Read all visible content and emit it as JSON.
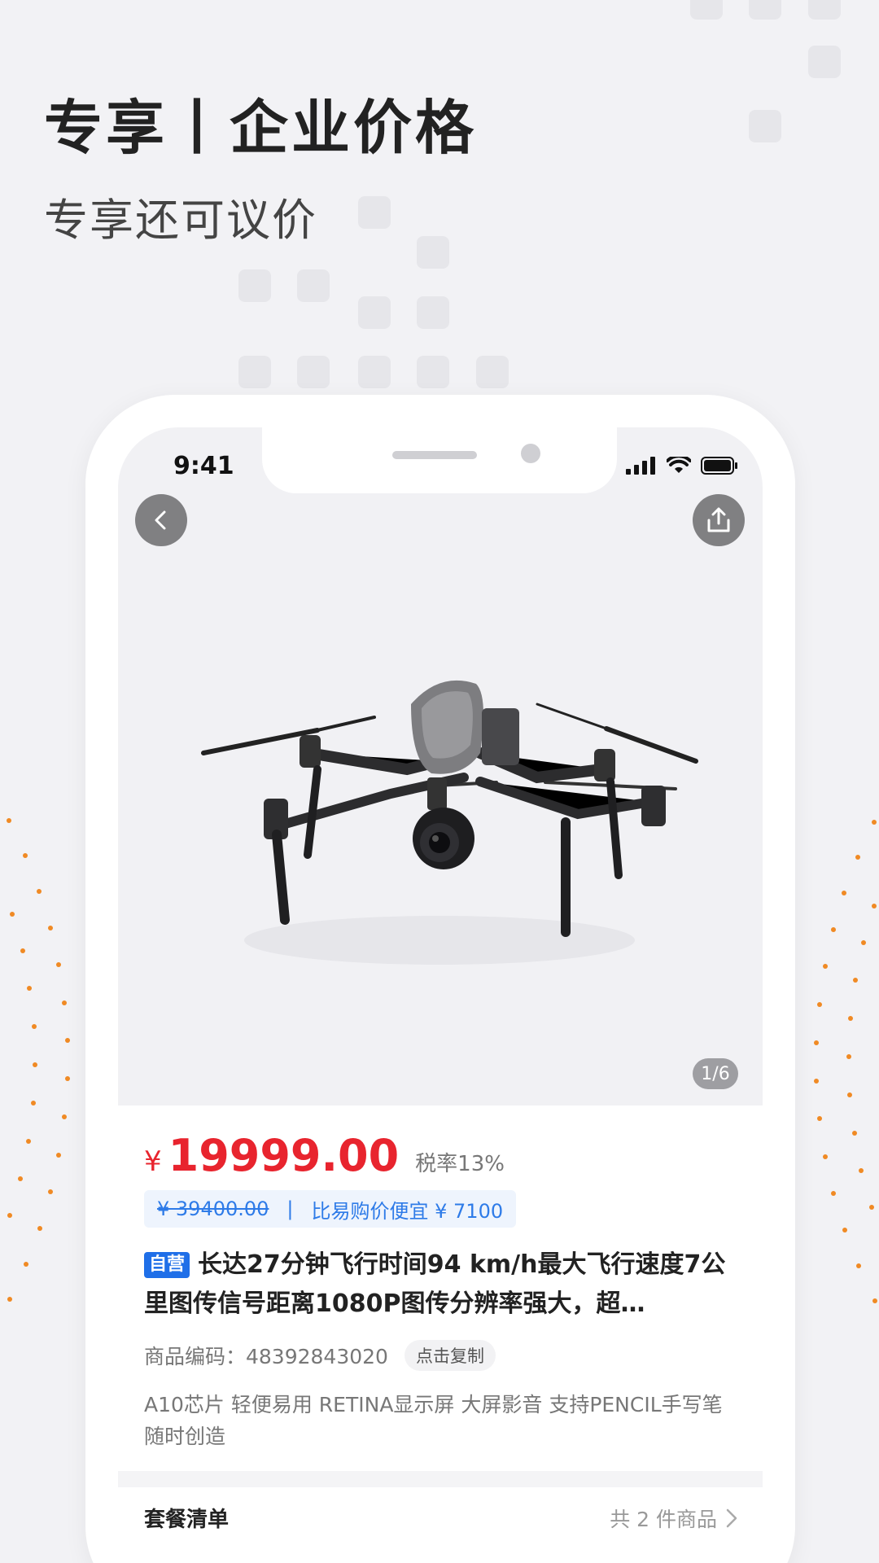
{
  "promo": {
    "title": "专享丨企业价格",
    "subtitle": "专享还可议价"
  },
  "status_bar": {
    "time": "9:41"
  },
  "hero": {
    "image_counter": "1/6"
  },
  "product": {
    "currency": "¥",
    "price": "19999.00",
    "tax": "税率13%",
    "original_price": "¥ 39400.00",
    "separator": "|",
    "savings": "比易购价便宜 ¥ 7100",
    "self_tag": "自营",
    "title": "长达27分钟飞行时间94 km/h最大飞行速度7公里图传信号距离1080P图传分辨率强大，超…",
    "code_label": "商品编码：48392843020",
    "copy_label": "点击复制",
    "description": "A10芯片 轻便易用 RETINA显示屏 大屏影音 支持PENCIL手写笔 随时创造"
  },
  "package": {
    "title": "套餐清单",
    "count": "共 2 件商品"
  },
  "colors": {
    "accent_red": "#e8242e",
    "accent_blue": "#2e7be8",
    "dot_orange": "#f08a24"
  }
}
